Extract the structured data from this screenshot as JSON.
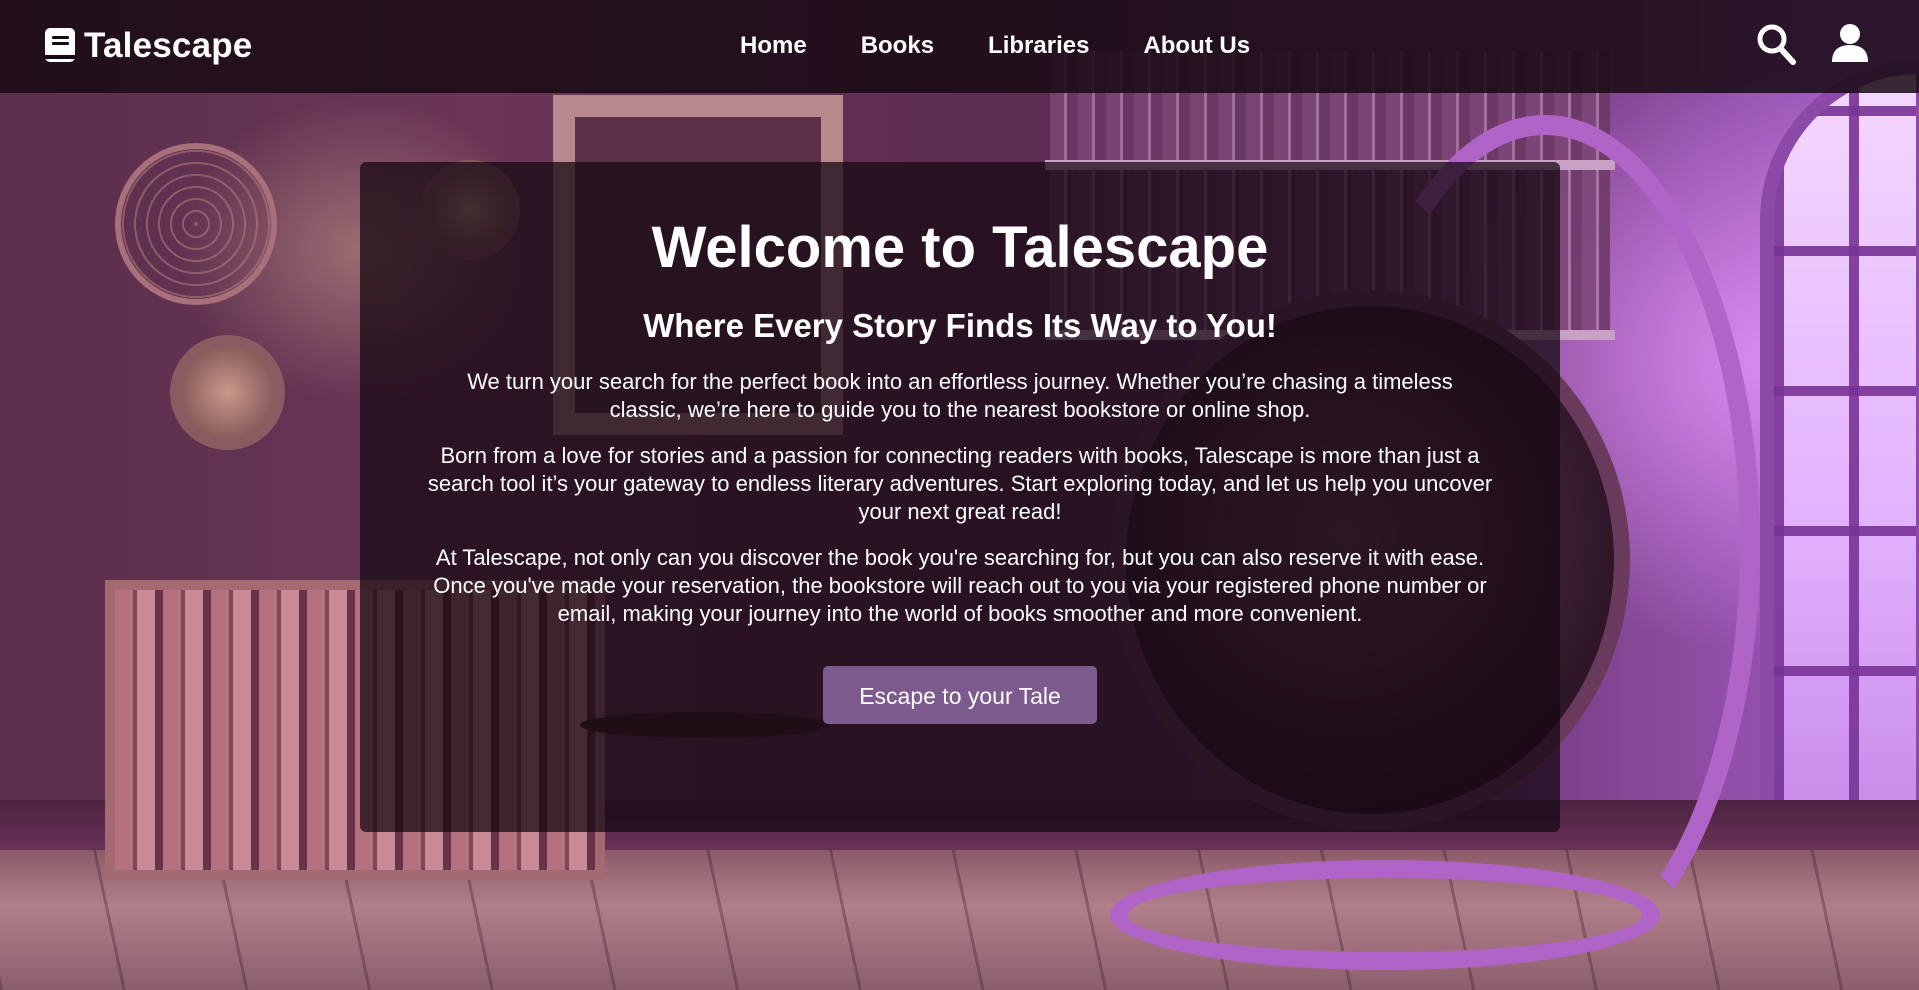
{
  "brand": {
    "name": "Talescape",
    "icon": "book-icon"
  },
  "nav": {
    "links": [
      {
        "label": "Home"
      },
      {
        "label": "Books"
      },
      {
        "label": "Libraries"
      },
      {
        "label": "About Us"
      }
    ],
    "icons": [
      "search-icon",
      "user-icon"
    ]
  },
  "hero": {
    "title": "Welcome to Talescape",
    "subtitle": "Where Every Story Finds Its Way to You!",
    "paragraphs": [
      "We turn your search for the perfect book into an effortless journey. Whether you’re chasing a timeless classic, we’re here to guide you to the nearest bookstore or online shop.",
      "Born from a love for stories and a passion for connecting readers with books, Talescape is more than just a search tool it’s your gateway to endless literary adventures. Start exploring today, and let us help you uncover your next great read!",
      "At Talescape, not only can you discover the book you're searching for, but you can also reserve it with ease. Once you've made your reservation, the bookstore will reach out to you via your registered phone number or email, making your journey into the world of books smoother and more convenient."
    ],
    "cta_label": "Escape to your Tale"
  },
  "colors": {
    "navbar_bg": "#180a14",
    "hero_bg": "#160812",
    "cta_bg": "#7c5a8d",
    "text": "#ffffff"
  }
}
